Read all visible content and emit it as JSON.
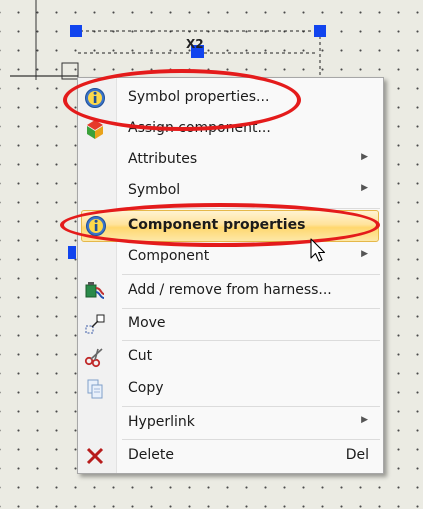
{
  "context_menu": {
    "items": [
      {
        "label": "Symbol properties...",
        "icon": "info-icon"
      },
      {
        "label": "Assign component...",
        "icon": "assign-component-icon"
      },
      {
        "label": "Attributes",
        "submenu": true
      },
      {
        "label": "Symbol",
        "submenu": true
      },
      {
        "label": "Component properties",
        "icon": "info-icon",
        "highlighted": true
      },
      {
        "label": "Component",
        "submenu": true
      },
      {
        "label": "Add / remove from harness...",
        "icon": "harness-icon"
      },
      {
        "label": "Move",
        "icon": "move-icon"
      },
      {
        "label": "Cut",
        "icon": "scissors-icon"
      },
      {
        "label": "Copy",
        "icon": "copy-icon"
      },
      {
        "label": "Hyperlink",
        "submenu": true
      },
      {
        "label": "Delete",
        "icon": "delete-icon",
        "shortcut": "Del"
      }
    ]
  },
  "annotation": {
    "color": "#e41b1b"
  },
  "colors": {
    "highlight": "#ffd76e",
    "selection_handle": "#1144ee",
    "background": "#ebebe3"
  }
}
